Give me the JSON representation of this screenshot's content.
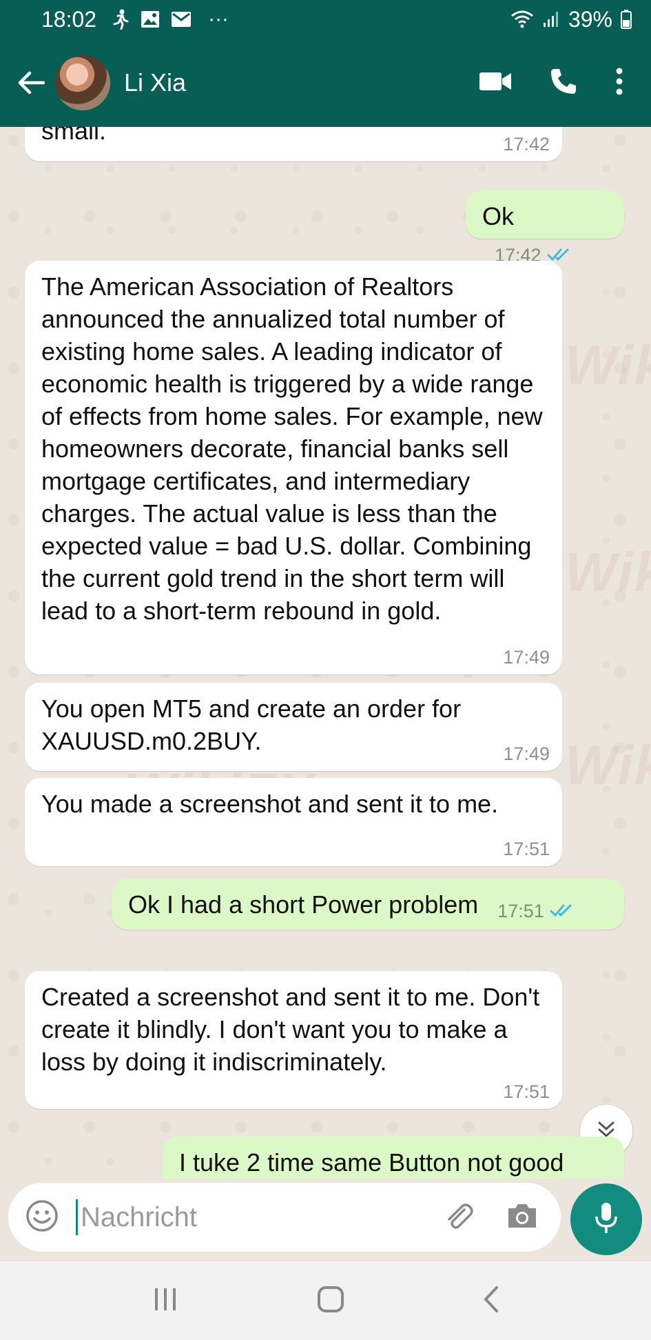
{
  "status_bar": {
    "time": "18:02",
    "battery": "39%",
    "dots": "···"
  },
  "header": {
    "contact_name": "Li Xia"
  },
  "messages": [
    {
      "direction": "in",
      "text": "small.",
      "time": "17:42"
    },
    {
      "direction": "out",
      "text": "Ok",
      "time": "17:42",
      "read": true
    },
    {
      "direction": "in",
      "text": "The American Association of Realtors announced the annualized total number of existing home sales. A leading indicator of economic health is triggered by a wide range of effects from home sales. For example, new homeowners decorate, financial banks sell mortgage certificates, and intermediary charges. The actual value is less than the expected value = bad U.S. dollar. Combining the current gold trend in the short term will lead to a short-term rebound in gold.",
      "time": "17:49"
    },
    {
      "direction": "in",
      "text": "You open MT5 and create an order for XAUUSD.m0.2BUY.",
      "time": "17:49"
    },
    {
      "direction": "in",
      "text": "You made a screenshot and sent it to me.",
      "time": "17:51"
    },
    {
      "direction": "out",
      "text": "Ok I had a short Power problem",
      "time": "17:51",
      "read": true
    },
    {
      "direction": "in",
      "text": "Created a screenshot and sent it to me. Don't create it blindly. I don't want you to make a loss by doing it indiscriminately.",
      "time": "17:51"
    },
    {
      "direction": "out",
      "text": "I tuke 2 time same Button not good",
      "time": ""
    }
  ],
  "composer": {
    "placeholder": "Nachricht"
  },
  "watermark": "WikiFX",
  "colors": {
    "header": "#075e54",
    "accent": "#128c7e",
    "outgoing": "#dcf8c6",
    "incoming": "#ffffff",
    "read_ticks": "#34b7f1"
  },
  "icons": [
    "walking-icon",
    "image-icon",
    "mail-icon",
    "wifi-icon",
    "signal-icon",
    "battery-icon",
    "back-arrow-icon",
    "video-call-icon",
    "phone-icon",
    "more-vert-icon",
    "chevron-double-down-icon",
    "emoji-icon",
    "attach-icon",
    "camera-icon",
    "mic-icon",
    "recents-icon",
    "home-icon",
    "back-icon"
  ]
}
